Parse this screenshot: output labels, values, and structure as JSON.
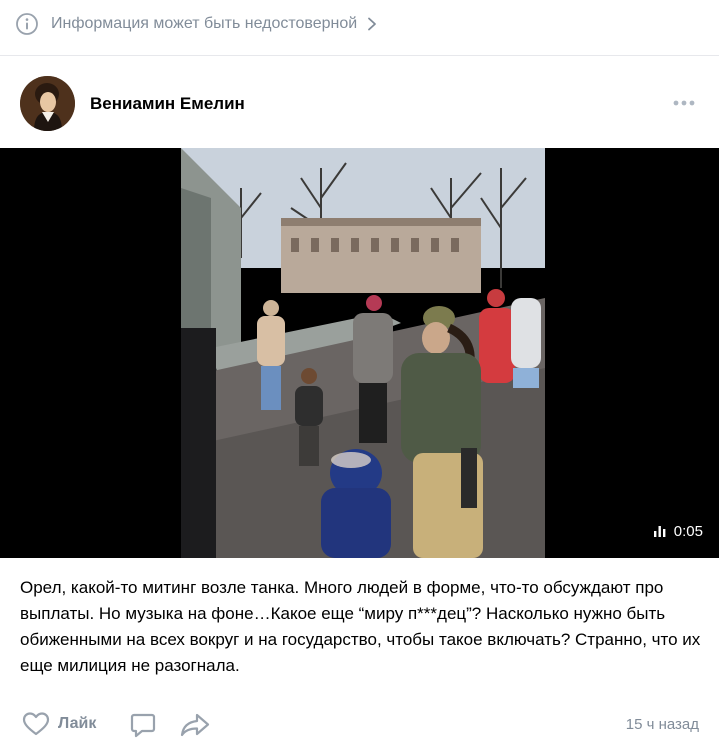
{
  "warning": {
    "text": "Информация может быть недостоверной"
  },
  "post": {
    "author": "Вениамин Емелин",
    "video_duration": "0:05",
    "text": "Орел, какой-то митинг возле танка. Много людей в форме, что-то обсуждают про выплаты. Но музыка на фоне…Какое еще “миру п***дец”? Насколько нужно быть обиженными на всех вокруг и на государство, чтобы такое включать? Странно, что их еще милиция не разогнала.",
    "like_label": "Лайк",
    "time": "15 ч назад"
  },
  "colors": {
    "muted": "#818c99",
    "divider": "#e7e8ec",
    "video_bg": "#000000"
  },
  "icons": {
    "warning": "info-icon",
    "warning_arrow": "chevron-right-icon",
    "more": "more-horizontal-icon",
    "duration": "audio-bars-icon",
    "like": "heart-icon",
    "comment": "comment-icon",
    "share": "share-icon"
  }
}
